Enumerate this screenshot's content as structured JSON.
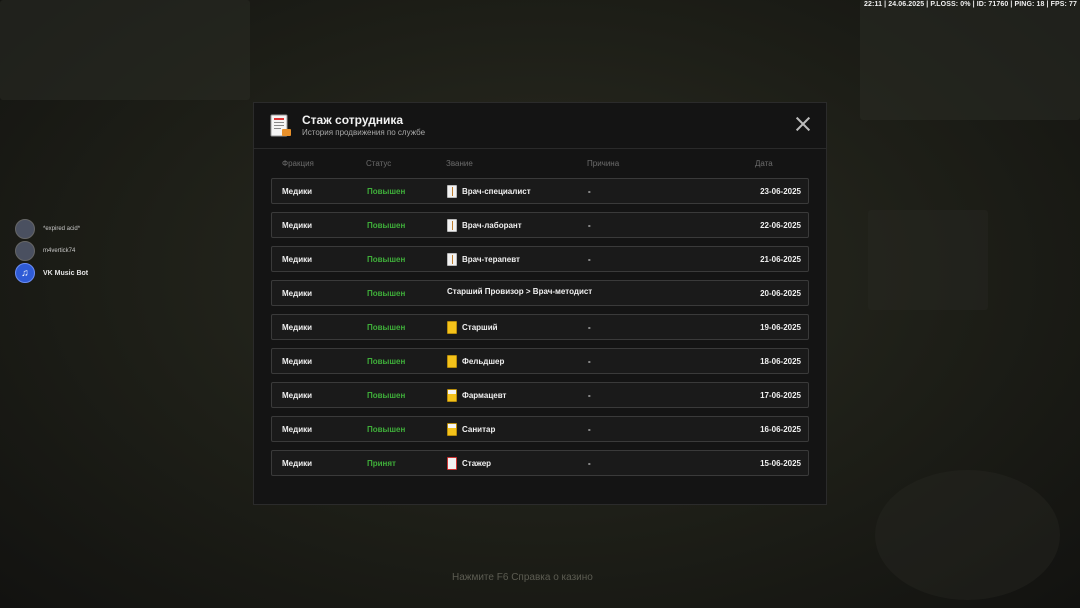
{
  "hud": {
    "stats": "22:11 | 24.06.2025 | P.LOSS: 0% | ID: 71760 | PING: 18 | FPS: 77"
  },
  "voice": [
    {
      "name": "*expired acid*"
    },
    {
      "name": "m4vertick74"
    },
    {
      "name": "VK Music Bot"
    }
  ],
  "background_hint": "Нажмите  F6  Справка о казино",
  "modal": {
    "title": "Стаж сотрудника",
    "subtitle": "История продвижения по службе",
    "columns": {
      "faction": "Фракция",
      "status": "Статус",
      "rank": "Звание",
      "reason": "Причина",
      "date": "Дата"
    },
    "rows": [
      {
        "faction": "Медики",
        "status": "Повышен",
        "rank": "Врач-специалист",
        "rank_icon": "white-book-icon",
        "reason": "-",
        "date": "23-06-2025"
      },
      {
        "faction": "Медики",
        "status": "Повышен",
        "rank": "Врач-лаборант",
        "rank_icon": "white-book-icon",
        "reason": "-",
        "date": "22-06-2025"
      },
      {
        "faction": "Медики",
        "status": "Повышен",
        "rank": "Врач-терапевт",
        "rank_icon": "white-book-icon",
        "reason": "-",
        "date": "21-06-2025"
      },
      {
        "faction": "Медики",
        "status": "Повышен",
        "rank": "Старший Провизор > Врач-методист",
        "rank_icon": "",
        "reason": "",
        "date": "20-06-2025"
      },
      {
        "faction": "Медики",
        "status": "Повышен",
        "rank": "Старший",
        "rank_icon": "yellow-card-icon",
        "reason": "-",
        "date": "19-06-2025"
      },
      {
        "faction": "Медики",
        "status": "Повышен",
        "rank": "Фельдшер",
        "rank_icon": "yellow-card-icon",
        "reason": "-",
        "date": "18-06-2025"
      },
      {
        "faction": "Медики",
        "status": "Повышен",
        "rank": "Фармацевт",
        "rank_icon": "half-yellow-card-icon",
        "reason": "-",
        "date": "17-06-2025"
      },
      {
        "faction": "Медики",
        "status": "Повышен",
        "rank": "Санитар",
        "rank_icon": "half-yellow-card-icon",
        "reason": "-",
        "date": "16-06-2025"
      },
      {
        "faction": "Медики",
        "status": "Принят",
        "rank": "Стажер",
        "rank_icon": "blank-card-icon",
        "reason": "-",
        "date": "15-06-2025"
      }
    ]
  },
  "colors": {
    "status_green": "#3fae3a",
    "modal_bg": "#141414",
    "row_border": "#3a3a3a"
  }
}
